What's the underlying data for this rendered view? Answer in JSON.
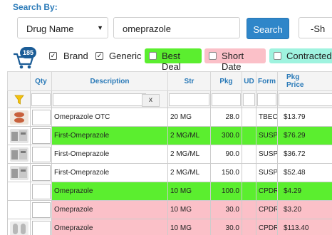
{
  "search": {
    "heading": "Search By:",
    "type_value": "Drug Name",
    "query_value": "omeprazole",
    "button_label": "Search",
    "sort_value": "-Sh"
  },
  "cart": {
    "count": "185"
  },
  "filters": {
    "brand": "Brand",
    "generic": "Generic",
    "best_deal": "Best Deal",
    "short_date": "Short Date",
    "contracted": "Contracted"
  },
  "colors": {
    "accent": "#2a7ab8",
    "button": "#2f86c9",
    "best_deal": "#5bee2f",
    "short_date": "#fbc0c8",
    "contracted": "#9ff3df"
  },
  "table": {
    "headers": {
      "qty": "Qty",
      "description": "Description",
      "str": "Str",
      "pkg": "Pkg",
      "ud": "UD",
      "form": "Form",
      "price": "Pkg\nPrice"
    },
    "filter_clear": "x",
    "rows": [
      {
        "description": "Omeprazole OTC",
        "str": "20 MG",
        "pkg": "28.0",
        "ud": "",
        "form": "TBEC",
        "price": "$13.79",
        "highlight": "none",
        "image": "pills"
      },
      {
        "description": "First-Omeprazole",
        "str": "2 MG/ML",
        "pkg": "300.0",
        "ud": "",
        "form": "SUSP",
        "price": "$76.29",
        "highlight": "green",
        "image": "kit"
      },
      {
        "description": "First-Omeprazole",
        "str": "2 MG/ML",
        "pkg": "90.0",
        "ud": "",
        "form": "SUSP",
        "price": "$36.72",
        "highlight": "none",
        "image": "kit"
      },
      {
        "description": "First-Omeprazole",
        "str": "2 MG/ML",
        "pkg": "150.0",
        "ud": "",
        "form": "SUSP",
        "price": "$52.48",
        "highlight": "none",
        "image": "kit"
      },
      {
        "description": "Omeprazole",
        "str": "10 MG",
        "pkg": "100.0",
        "ud": "",
        "form": "CPDR",
        "price": "$4.29",
        "highlight": "green",
        "image": ""
      },
      {
        "description": "Omeprazole",
        "str": "10 MG",
        "pkg": "30.0",
        "ud": "",
        "form": "CPDR",
        "price": "$3.20",
        "highlight": "pink",
        "image": ""
      },
      {
        "description": "Omeprazole",
        "str": "10 MG",
        "pkg": "30.0",
        "ud": "",
        "form": "CPDR",
        "price": "$113.40",
        "highlight": "pink",
        "image": "capsule"
      }
    ]
  }
}
